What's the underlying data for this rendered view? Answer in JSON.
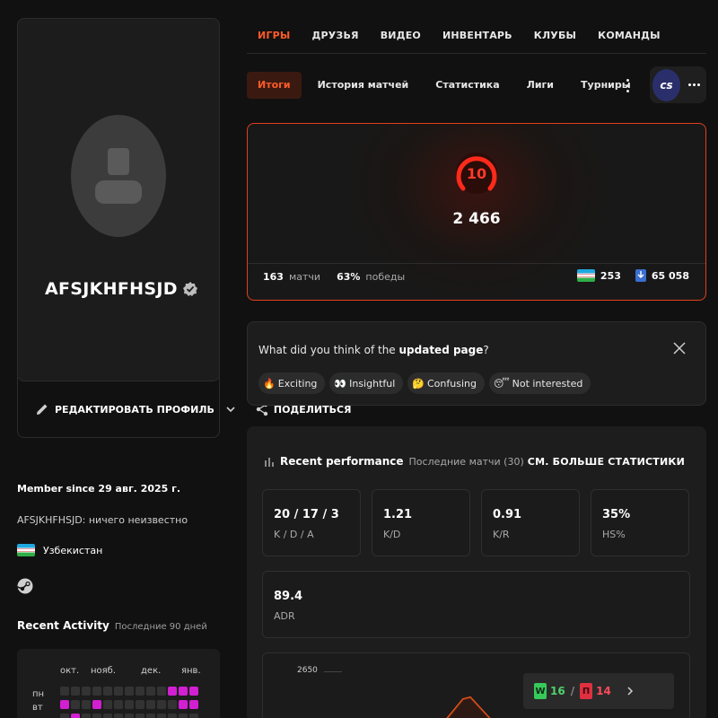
{
  "profile": {
    "username": "AFSJKHFHSJD",
    "edit_label": "РЕДАКТИРОВАТЬ ПРОФИЛЬ",
    "share_label": "ПОДЕЛИТЬСЯ",
    "member_since": "Member since 29 авг. 2025 г.",
    "bio": "AFSJKHFHSJD: ничего неизвестно",
    "country": "Узбекистан"
  },
  "activity": {
    "title": "Recent Activity",
    "subtitle": "Последние 90 дней",
    "months": [
      "окт.",
      "нояб.",
      "дек.",
      "янв."
    ],
    "days": [
      "пн",
      "вт"
    ],
    "rows": [
      [
        0,
        0,
        0,
        0,
        0,
        0,
        0,
        0,
        0,
        0,
        1,
        1,
        1
      ],
      [
        1,
        0,
        0,
        1,
        0,
        0,
        0,
        0,
        0,
        0,
        0,
        1,
        1
      ],
      [
        0,
        1,
        0,
        0,
        0,
        0,
        0,
        0,
        0,
        0,
        0,
        0,
        0
      ]
    ],
    "colors": {
      "active": "#d21fd2",
      "inactive": "#333333"
    }
  },
  "nav": {
    "main": [
      "ИГРЫ",
      "ДРУЗЬЯ",
      "ВИДЕО",
      "ИНВЕНТАРЬ",
      "КЛУБЫ",
      "КОМАНДЫ"
    ],
    "active_main": 0,
    "sub": [
      "Итоги",
      "История матчей",
      "Статистика",
      "Лиги",
      "Турниры"
    ],
    "active_sub": 0,
    "game_badge": "cs"
  },
  "elo": {
    "level": "10",
    "value": "2 466",
    "matches": "163",
    "matches_label": "матчи",
    "winrate": "63%",
    "winrate_label": "победы",
    "country_rank": "253",
    "world_rank": "65 058",
    "accent": "#e0401a"
  },
  "feedback": {
    "question_prefix": "What did you think of the ",
    "question_bold": "updated page",
    "question_suffix": "?",
    "chips": [
      {
        "emoji": "🔥",
        "label": "Exciting"
      },
      {
        "emoji": "👀",
        "label": "Insightful"
      },
      {
        "emoji": "🤔",
        "label": "Confusing"
      },
      {
        "emoji": "😴",
        "label": "Not interested"
      }
    ]
  },
  "performance": {
    "title": "Recent performance",
    "subtitle": "Последние матчи (30)",
    "more_label": "СМ. БОЛЬШЕ СТАТИСТИКИ",
    "stats": [
      {
        "value": "20 / 17 / 3",
        "label": "K / D / A"
      },
      {
        "value": "1.21",
        "label": "K/D"
      },
      {
        "value": "0.91",
        "label": "K/R"
      },
      {
        "value": "35%",
        "label": "HS%"
      },
      {
        "value": "89.4",
        "label": "ADR"
      }
    ],
    "chart_y_label": "2650",
    "wins_letter": "W",
    "wins": "16",
    "losses_letter": "П",
    "losses": "14"
  }
}
